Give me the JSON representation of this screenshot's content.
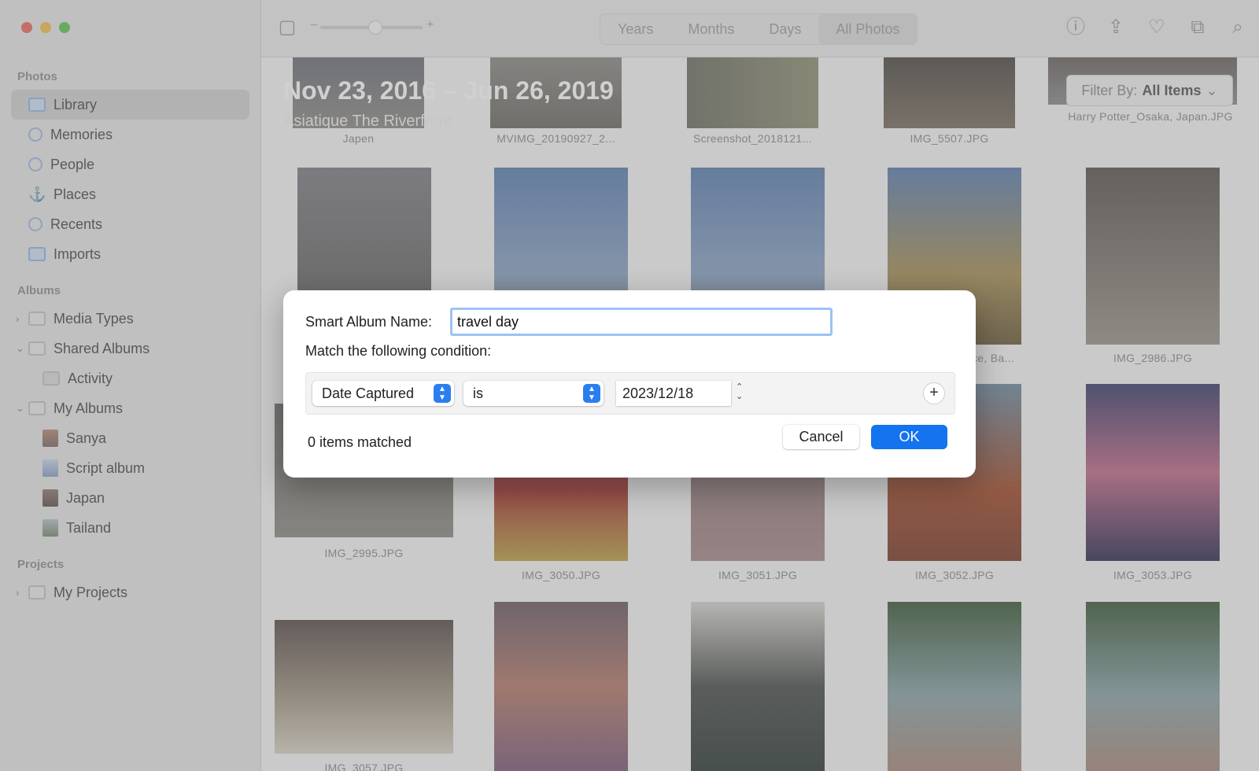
{
  "window": {
    "sidebar": {
      "sections": {
        "photos": "Photos",
        "albums": "Albums",
        "projects": "Projects"
      },
      "photos_items": [
        "Library",
        "Memories",
        "People",
        "Places",
        "Recents",
        "Imports"
      ],
      "albums_items": {
        "media_types": "Media Types",
        "shared_albums": "Shared Albums",
        "activity": "Activity",
        "my_albums": "My Albums",
        "sanya": "Sanya",
        "script_album": "Script album",
        "japan": "Japan",
        "tailand": "Tailand"
      },
      "projects_items": {
        "my_projects": "My Projects"
      }
    },
    "toolbar": {
      "views": [
        "Years",
        "Months",
        "Days",
        "All Photos"
      ],
      "active_view": "All Photos"
    },
    "header": {
      "title": "Nov 23, 2016 – Jun 26, 2019",
      "subtitle": "Asiatique The Riverfront",
      "filter_label": "Filter By:",
      "filter_value": "All Items"
    },
    "grid": {
      "filenames": {
        "r0c0": "Japen",
        "r0c1": "MVIMG_20190927_2...",
        "r0c2": "Screenshot_2018121...",
        "r0c3": "IMG_5507.JPG",
        "r0c4": "Harry Potter_Osaka, Japan.JPG",
        "r1c3": "ce, Ba...",
        "r1c4": "IMG_2986.JPG",
        "r2c0": "IMG_2995.JPG",
        "r2c1": "IMG_3050.JPG",
        "r2c2": "IMG_3051.JPG",
        "r2c3": "IMG_3052.JPG",
        "r2c4": "IMG_3053.JPG",
        "r3c0": "IMG_3057.JPG"
      }
    }
  },
  "dialog": {
    "name_label": "Smart Album Name:",
    "name_value": "travel day",
    "condition_label": "Match the following condition:",
    "field_popup": "Date Captured",
    "operator_popup": "is",
    "date_value": "2023/12/18",
    "matched_text": "0 items matched",
    "cancel_label": "Cancel",
    "ok_label": "OK"
  },
  "colors": {
    "accent": "#1473ee",
    "focus_ring": "#9cc3f4"
  }
}
